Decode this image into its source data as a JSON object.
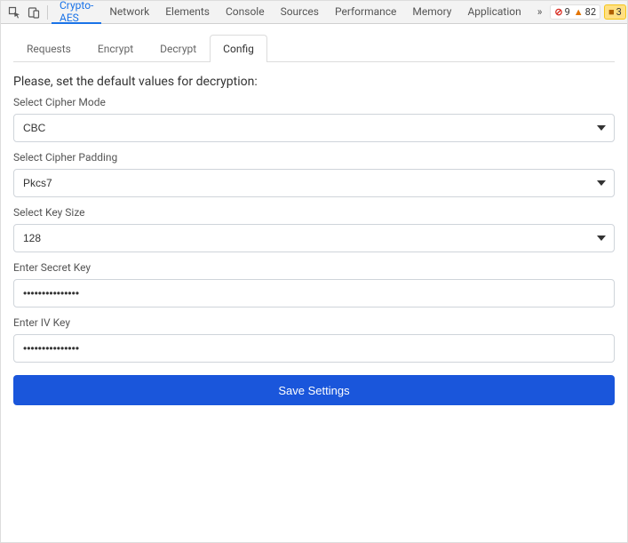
{
  "devtools": {
    "tabs": [
      "Crypto-AES",
      "Network",
      "Elements",
      "Console",
      "Sources",
      "Performance",
      "Memory",
      "Application"
    ],
    "activeTab": "Crypto-AES",
    "overflow_glyph": "»",
    "errors": {
      "icon": "⊘",
      "count": "9"
    },
    "warnings": {
      "icon": "▲",
      "count": "82"
    },
    "messages": {
      "icon": "■",
      "count": "3"
    }
  },
  "panel": {
    "tabs": {
      "requests": "Requests",
      "encrypt": "Encrypt",
      "decrypt": "Decrypt",
      "config": "Config"
    },
    "activeTab": "config",
    "heading": "Please, set the default values for decryption:",
    "cipherMode": {
      "label": "Select Cipher Mode",
      "value": "CBC"
    },
    "cipherPadding": {
      "label": "Select Cipher Padding",
      "value": "Pkcs7"
    },
    "keySize": {
      "label": "Select Key Size",
      "value": "128"
    },
    "secretKey": {
      "label": "Enter Secret Key",
      "value": "•••••••••••••••"
    },
    "ivKey": {
      "label": "Enter IV Key",
      "value": "•••••••••••••••"
    },
    "saveLabel": "Save Settings"
  }
}
